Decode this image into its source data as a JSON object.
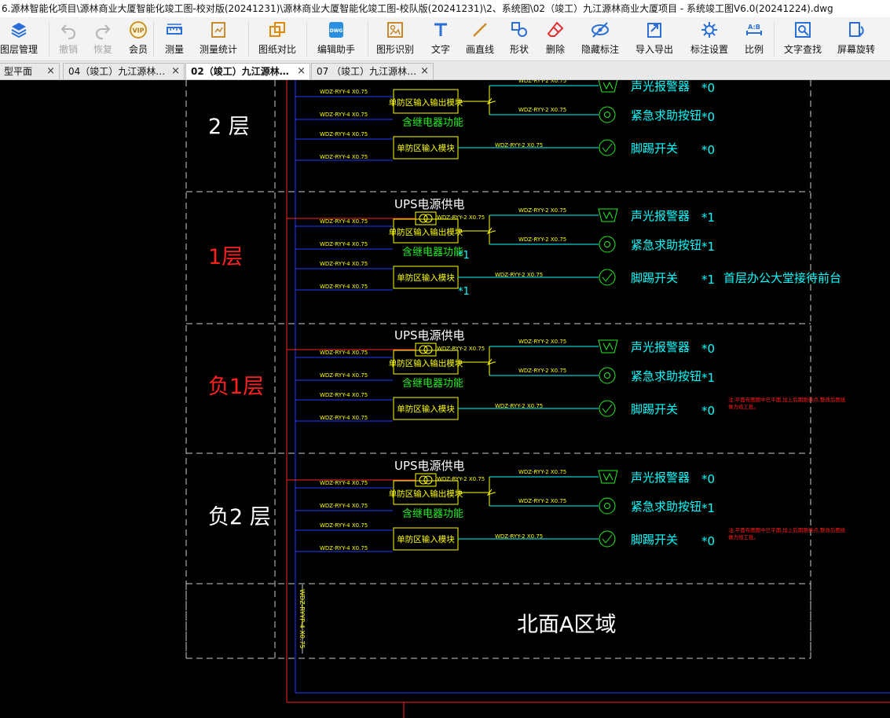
{
  "window": {
    "title": "6.源林智能化项目\\源林商业大厦智能化竣工图-校对版(20241231)\\源林商业大厦智能化竣工图-校队版(20241231)\\2、系统图\\02（竣工）九江源林商业大厦项目 - 系统竣工图V6.0(20241224).dwg"
  },
  "toolbar": {
    "items": [
      {
        "label": "图层管理",
        "icon": "layers-icon",
        "enabled": true
      },
      {
        "label": "撤销",
        "icon": "undo-icon",
        "enabled": false
      },
      {
        "label": "恢复",
        "icon": "redo-icon",
        "enabled": false
      },
      {
        "label": "会员",
        "icon": "vip-icon",
        "badge": "VIP",
        "enabled": true
      },
      {
        "label": "测量",
        "icon": "ruler-icon",
        "enabled": true
      },
      {
        "label": "测量统计",
        "icon": "measure-stats-icon",
        "enabled": true
      },
      {
        "label": "图纸对比",
        "icon": "compare-icon",
        "enabled": true
      },
      {
        "label": "编辑助手",
        "icon": "edit-assistant-icon",
        "badge": "DWG",
        "enabled": true
      },
      {
        "label": "图形识别",
        "icon": "shape-recognize-icon",
        "enabled": true
      },
      {
        "label": "文字",
        "icon": "text-icon",
        "enabled": true
      },
      {
        "label": "画直线",
        "icon": "line-icon",
        "enabled": true
      },
      {
        "label": "形状",
        "icon": "shape-icon",
        "enabled": true
      },
      {
        "label": "删除",
        "icon": "eraser-icon",
        "enabled": true
      },
      {
        "label": "隐藏标注",
        "icon": "hide-icon",
        "enabled": true
      },
      {
        "label": "导入导出",
        "icon": "import-export-icon",
        "enabled": true
      },
      {
        "label": "标注设置",
        "icon": "annotation-settings-icon",
        "enabled": true
      },
      {
        "label": "比例",
        "icon": "scale-icon",
        "badge": "A:B",
        "enabled": true
      },
      {
        "label": "文字查找",
        "icon": "text-search-icon",
        "enabled": true
      },
      {
        "label": "屏幕旋转",
        "icon": "rotate-screen-icon",
        "enabled": true
      }
    ]
  },
  "tabs": [
    {
      "label": "型平面",
      "active": false
    },
    {
      "label": "04（竣工）九江源林…",
      "active": false
    },
    {
      "label": "02（竣工）九江源林…",
      "active": true
    },
    {
      "label": "07 （竣工）九江源林…",
      "active": false
    }
  ],
  "drawing": {
    "colors": {
      "white": "#ffffff",
      "blue": "#1f3cff",
      "red": "#ff2020",
      "yellow": "#ffff00",
      "green": "#22ee22",
      "cyan": "#00ffff",
      "gray": "#cccccc"
    },
    "wire_small": "WDZ-RYY-4 X0.75",
    "wire_dev": "WDZ-RYY-2 X0.75",
    "vertical_cable": "WDZ-RYYP-4 X0.75",
    "module_io": "单防区输入输出模块",
    "module_in": "单防区输入模块",
    "relay_note": "含继电器功能",
    "ups_label": "UPS电源供电",
    "dev_alarm": "声光报警器",
    "dev_button": "紧急求助按钮",
    "dev_foot": "脚踢开关",
    "area_label": "北面A区域",
    "floors": [
      {
        "name": "2 层",
        "red": false,
        "alarm_qty": "*0",
        "button_qty": "*0",
        "foot_qty": "*0",
        "ups": false,
        "relay_star": "",
        "foot_star": "",
        "note": "",
        "note_red": ""
      },
      {
        "name": "1层",
        "red": true,
        "alarm_qty": "*1",
        "button_qty": "*1",
        "foot_qty": "*1",
        "ups": true,
        "relay_star": "*1",
        "foot_star": "*1",
        "note": "首层办公大堂接待前台",
        "note_red": ""
      },
      {
        "name": "负1层",
        "red": true,
        "alarm_qty": "*0",
        "button_qty": "*1",
        "foot_qty": "*0",
        "ups": true,
        "relay_star": "",
        "foot_star": "",
        "note": "",
        "note_red": "注:平面布图图中已平面,加上后期跟换点,整改后图纸做为竣工批。"
      },
      {
        "name": "负2 层",
        "red": false,
        "alarm_qty": "*0",
        "button_qty": "*1",
        "foot_qty": "*0",
        "ups": true,
        "relay_star": "",
        "foot_star": "",
        "note": "",
        "note_red": "注:平面布图图中已平面,加上后期跟换点,整改后图纸做为竣工批。"
      }
    ]
  }
}
